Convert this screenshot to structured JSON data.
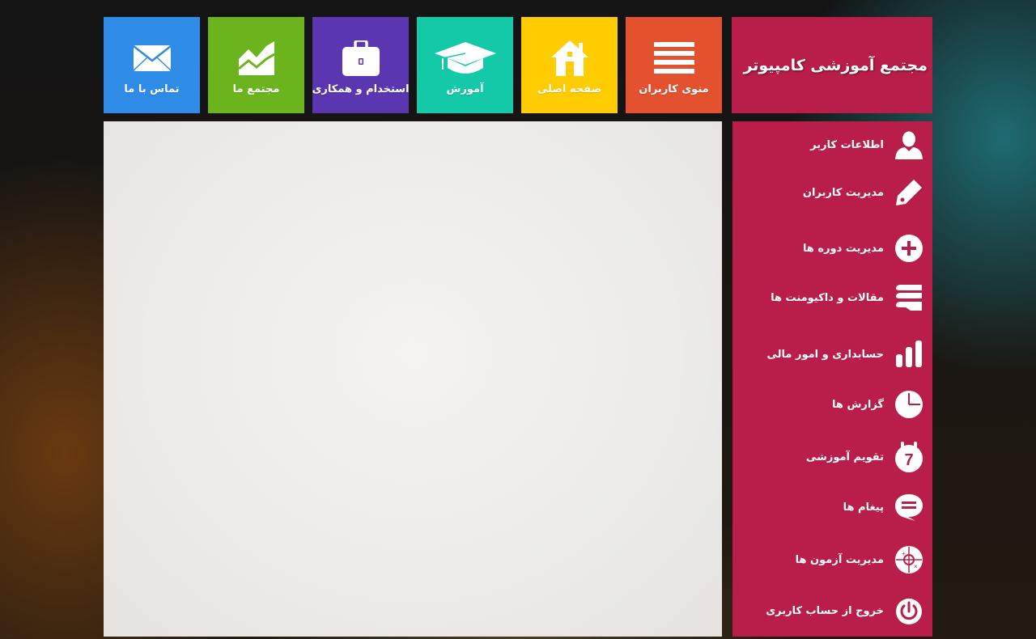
{
  "brand": {
    "title": "مجتمع آموزشی کامپیوتر"
  },
  "top_nav": [
    {
      "label": "تماس با ما",
      "icon": "envelope-icon",
      "color": "#2e8ce6"
    },
    {
      "label": "مجتمع ما",
      "icon": "chart-area-icon",
      "color": "#6cb41e"
    },
    {
      "label": "استخدام و همکاری",
      "icon": "briefcase-icon",
      "color": "#5a36b0"
    },
    {
      "label": "آموزش",
      "icon": "graduation-cap-icon",
      "color": "#14c9a8"
    },
    {
      "label": "صفحه اصلی",
      "icon": "home-icon",
      "color": "#ffcc00"
    },
    {
      "label": "منوی کاربران",
      "icon": "menu-lines-icon",
      "color": "#e3512e"
    }
  ],
  "sidebar": {
    "items": [
      {
        "label": "اطلاعات کاربر",
        "icon": "user-icon"
      },
      {
        "label": "مدیریت کاربران",
        "icon": "pencil-icon"
      },
      {
        "label": "مدیریت دوره ها",
        "icon": "plus-circle-icon"
      },
      {
        "label": "مقالات و داکیومنت ها",
        "icon": "books-icon"
      },
      {
        "label": "حسابداری و امور مالی",
        "icon": "bar-chart-icon"
      },
      {
        "label": "گزارش ها",
        "icon": "pie-chart-icon"
      },
      {
        "label": "تقویم آموزشی",
        "icon": "calendar-icon",
        "calendar_day": "7"
      },
      {
        "label": "پیغام ها",
        "icon": "chat-bubble-icon"
      },
      {
        "label": "مدیریت آزمون ها",
        "icon": "target-icon"
      },
      {
        "label": "خروج از حساب کاربری",
        "icon": "power-icon"
      }
    ]
  },
  "colors": {
    "accent": "#b81e49"
  }
}
